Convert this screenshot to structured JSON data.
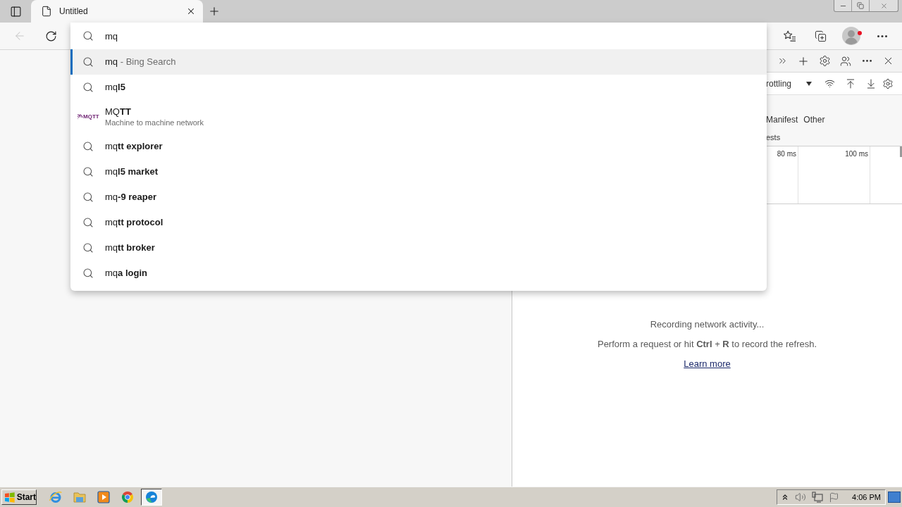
{
  "tabs": [
    {
      "title": "Untitled",
      "selected": true
    }
  ],
  "toolbar": {
    "back_disabled": true,
    "profile_badge": true
  },
  "omnibox": {
    "value": "mq",
    "suggestions": [
      {
        "kind": "search",
        "text": "mq",
        "suffix": "- Bing Search",
        "selected": true
      },
      {
        "kind": "search",
        "text": "mq**l5**",
        "selected": false
      },
      {
        "kind": "entity",
        "logo": "MQTT",
        "text": "MQ**TT**",
        "subtitle": "Machine to machine network",
        "selected": false
      },
      {
        "kind": "search",
        "text": "mq**tt explorer**",
        "selected": false
      },
      {
        "kind": "search",
        "text": "mq**l5 market**",
        "selected": false
      },
      {
        "kind": "search",
        "text": "mq**-9 reaper**",
        "selected": false
      },
      {
        "kind": "search",
        "text": "mq**tt protocol**",
        "selected": false
      },
      {
        "kind": "search",
        "text": "mq**tt broker**",
        "selected": false
      },
      {
        "kind": "search",
        "text": "mq**a login**",
        "selected": false
      }
    ]
  },
  "devtools": {
    "throttling": "rottling",
    "filters": [
      "Manifest",
      "Other"
    ],
    "filter_note": "ests",
    "ticks": [
      "80 ms",
      "100 ms"
    ],
    "status": "Recording network activity...",
    "hint": "Perform a request or hit **Ctrl** + **R** to record the refresh.",
    "link": "Learn more"
  },
  "taskbar": {
    "start": "Start",
    "apps": [
      {
        "kind": "ie",
        "selected": false
      },
      {
        "kind": "folder",
        "selected": false
      },
      {
        "kind": "media",
        "selected": false
      },
      {
        "kind": "chrome",
        "selected": false
      },
      {
        "kind": "edge",
        "selected": true
      }
    ],
    "clock": "4:06 PM"
  }
}
